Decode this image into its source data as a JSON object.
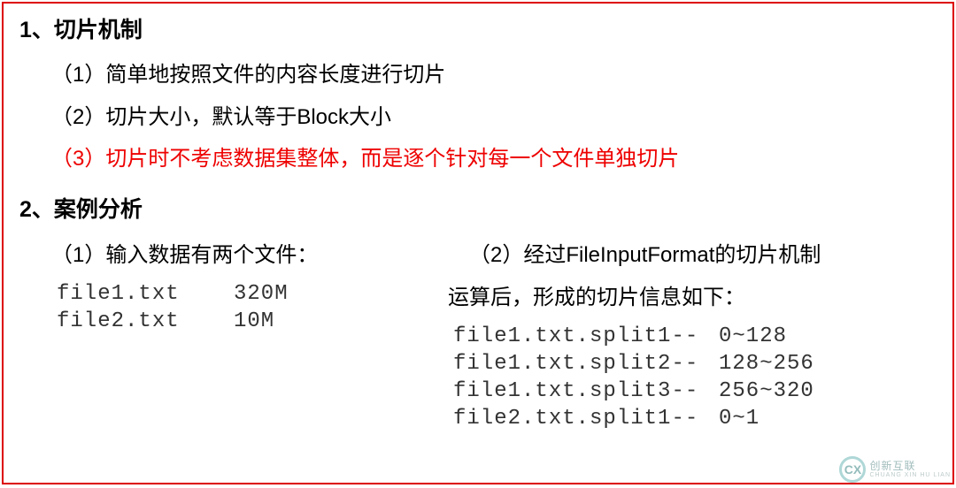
{
  "section1": {
    "heading": "1、切片机制",
    "items": [
      "（1）简单地按照文件的内容长度进行切片",
      "（2）切片大小，默认等于Block大小",
      "（3）切片时不考虑数据集整体，而是逐个针对每一个文件单独切片"
    ]
  },
  "section2": {
    "heading": "2、案例分析",
    "left": {
      "title": "（1）输入数据有两个文件：",
      "files": [
        {
          "name": "file1.txt",
          "size": "320M"
        },
        {
          "name": "file2.txt",
          "size": "10M"
        }
      ]
    },
    "right": {
      "title_line1": "（2）经过FileInputFormat的切片机制",
      "title_line2": "运算后，形成的切片信息如下：",
      "splits": [
        {
          "name": "file1.txt.split1--",
          "range": "0~128"
        },
        {
          "name": "file1.txt.split2--",
          "range": "128~256"
        },
        {
          "name": "file1.txt.split3--",
          "range": "256~320"
        },
        {
          "name": "file2.txt.split1--",
          "range": "0~1"
        }
      ]
    }
  },
  "watermark": {
    "logo": "CX",
    "text_cn": "创新互联",
    "text_en": "CHUANG XIN HU LIAN"
  }
}
